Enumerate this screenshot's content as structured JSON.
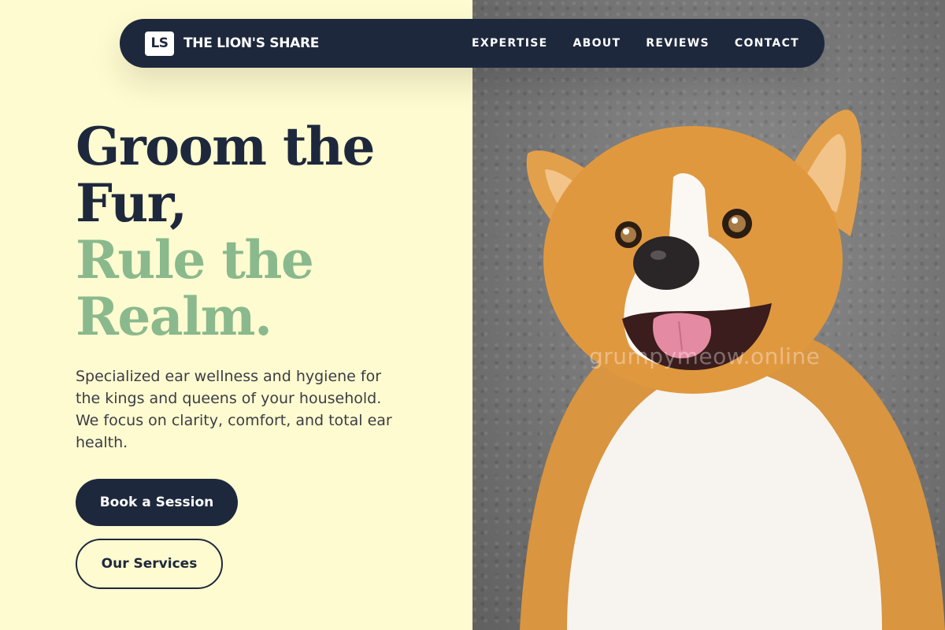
{
  "nav": {
    "logo_text": "LS",
    "brand": "THE LION'S SHARE",
    "links": [
      "EXPERTISE",
      "ABOUT",
      "REVIEWS",
      "CONTACT"
    ]
  },
  "hero": {
    "headline_dark": [
      "Groom the",
      "Fur,"
    ],
    "headline_accent": [
      "Rule the",
      "Realm."
    ],
    "description": "Specialized ear wellness and hygiene for the kings and queens of your household. We focus on clarity, comfort, and total ear health.",
    "primary_button": "Book a Session",
    "secondary_button": "Our Services"
  },
  "photo": {
    "watermark": "grumpymeow.online",
    "subject_icon": "corgi-photo"
  },
  "colors": {
    "background": "#fffbd0",
    "navy": "#1e283d",
    "accent_green": "#8ab98d"
  }
}
